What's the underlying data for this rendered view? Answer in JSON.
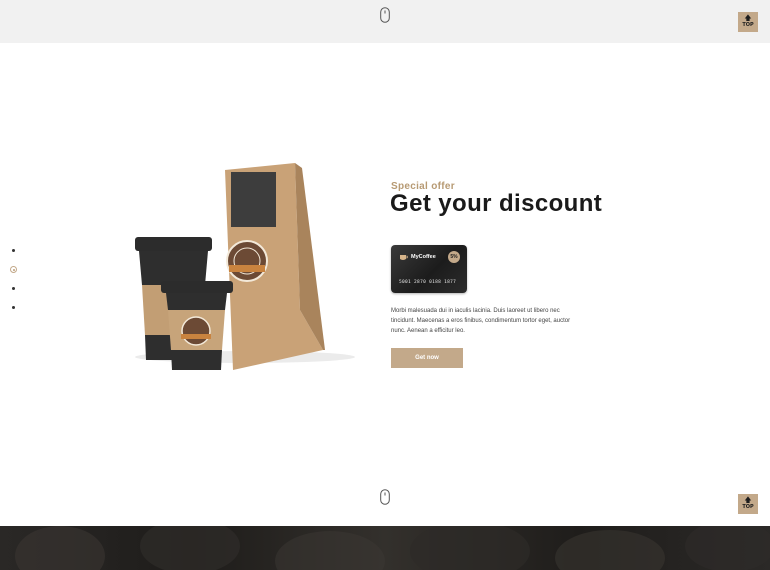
{
  "header": {
    "scroll_icon": "mouse-icon",
    "top_button": {
      "arrow": "🡅",
      "label": "TOP"
    }
  },
  "pagination": {
    "count": 4,
    "active_index": 1
  },
  "offer": {
    "eyebrow": "Special offer",
    "title": "Get your discount",
    "card": {
      "brand": "MyCoffee",
      "discount": "5%",
      "number": "5001 2870 0188 1877"
    },
    "description": "Morbi malesuada dui in iaculis lacinia. Duis laoreet ut libero nec tincidunt. Maecenas a eros finibus, condimentum tortor eget, auctor nunc. Aenean a efficitur leo.",
    "cta_label": "Get now"
  },
  "footer": {
    "scroll_icon": "mouse-icon",
    "top_button": {
      "arrow": "🡅",
      "label": "TOP"
    }
  },
  "colors": {
    "accent": "#c3a98a",
    "heading": "#1a1a1a",
    "top_strip": "#f1f1f1"
  }
}
